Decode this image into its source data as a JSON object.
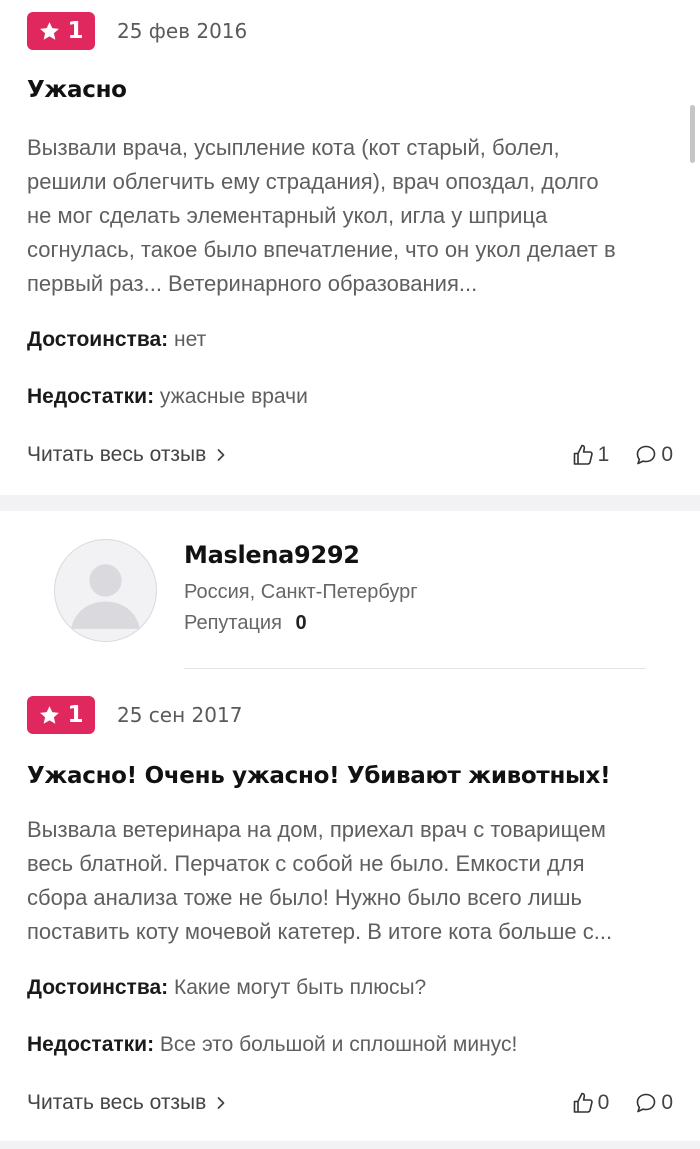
{
  "reviews": [
    {
      "rating": "1",
      "date": "25 фев 2016",
      "title": "Ужасно",
      "text_lines": [
        "Вызвали врача, усыпление кота (кот старый, болел,",
        "решили облегчить ему страдания), врач опоздал, долго",
        "не мог сделать элементарный укол, игла у шприца",
        "согнулась, такое было впечатление, что он укол делает в",
        "первый раз... Ветеринарного образования..."
      ],
      "pros_label": "Достоинства:",
      "pros_value": "нет",
      "cons_label": "Недостатки:",
      "cons_value": "ужасные врачи",
      "read_more": "Читать весь отзыв",
      "likes": "1",
      "comments": "0"
    },
    {
      "user": {
        "name": "Maslena9292",
        "location": "Россия, Санкт-Петербург",
        "reputation_label": "Репутация",
        "reputation_value": "0"
      },
      "rating": "1",
      "date": "25 сен 2017",
      "title": "Ужасно! Очень ужасно! Убивают животных!",
      "text_lines": [
        "Вызвала ветеринара на дом, приехал врач с товарищем",
        "весь блатной. Перчаток с собой не было. Емкости для",
        "сбора анализа тоже не было! Нужно было всего лишь",
        "поставить коту мочевой катетер. В итоге кота больше с..."
      ],
      "pros_label": "Достоинства:",
      "pros_value": "Какие могут быть плюсы?",
      "cons_label": "Недостатки:",
      "cons_value": "Все это большой и сплошной минус!",
      "read_more": "Читать весь отзыв",
      "likes": "0",
      "comments": "0"
    }
  ],
  "colors": {
    "badge": "#e0285f",
    "separator": "#f2f2f4"
  },
  "icons": {
    "rating": "star-icon",
    "read_more": "chevron-right-icon",
    "likes": "thumbs-up-icon",
    "comments": "comment-bubble-icon",
    "avatar": "default-user-avatar"
  }
}
